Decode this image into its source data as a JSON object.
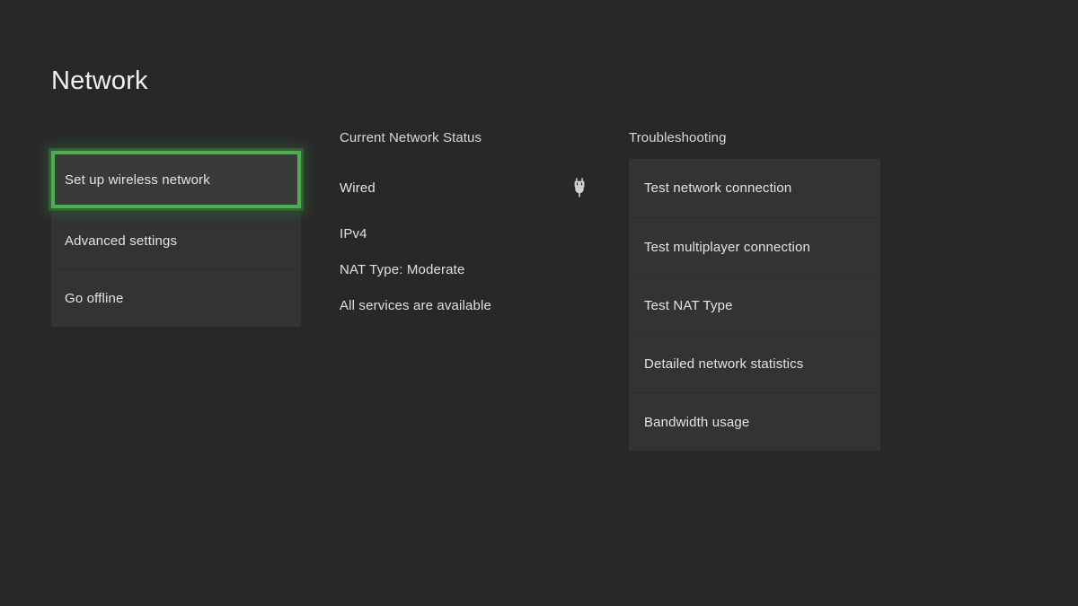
{
  "page": {
    "title": "Network"
  },
  "menu": {
    "items": [
      {
        "label": "Set up wireless network",
        "focused": true
      },
      {
        "label": "Advanced settings",
        "focused": false
      },
      {
        "label": "Go offline",
        "focused": false
      }
    ]
  },
  "status": {
    "header": "Current Network Status",
    "connection_type": "Wired",
    "connection_icon": "ethernet-plug-icon",
    "details": [
      "IPv4",
      "NAT Type: Moderate",
      "All services are available"
    ]
  },
  "troubleshooting": {
    "header": "Troubleshooting",
    "items": [
      {
        "label": "Test network connection"
      },
      {
        "label": "Test multiplayer connection"
      },
      {
        "label": "Test NAT Type"
      },
      {
        "label": "Detailed network statistics"
      },
      {
        "label": "Bandwidth usage"
      }
    ]
  },
  "colors": {
    "background": "#282828",
    "tile": "#333333",
    "focus_green": "#4caf50",
    "text": "#e4e4e4"
  }
}
